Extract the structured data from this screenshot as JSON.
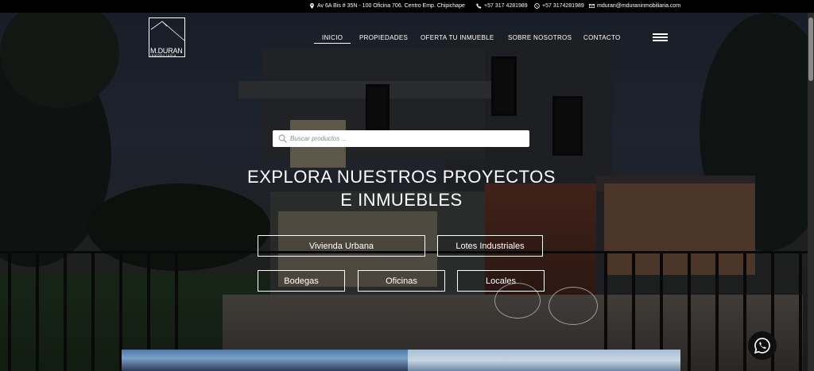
{
  "topbar": {
    "address": "Av 6A Bis # 35N - 100 Oficina 706. Centro Emp. Chipichape",
    "phone": "+57 317 4281989",
    "whatsapp": "+57 3174281989",
    "email": "mduran@mduraninmobiliaria.com"
  },
  "logo": {
    "name": "M.DURAN",
    "subtitle": "INMOBILIARIA"
  },
  "nav": {
    "items": [
      "INICIO",
      "PROPIEDADES",
      "OFERTA TU INMUEBLE",
      "SOBRE NOSOTROS",
      "CONTACTO"
    ],
    "active": "INICIO"
  },
  "search": {
    "placeholder": "Buscar productos ..."
  },
  "hero": {
    "headline_line1": "EXPLORA NUESTROS PROYECTOS",
    "headline_line2": "E INMUEBLES"
  },
  "categories": [
    "Vivienda Urbana",
    "Lotes Industriales",
    "Bodegas",
    "Oficinas",
    "Locales"
  ],
  "icons": {
    "address": "location-pin-icon",
    "phone": "phone-icon",
    "whatsapp": "whatsapp-icon",
    "email": "envelope-icon",
    "search": "search-icon",
    "menu": "hamburger-menu-icon"
  },
  "colors": {
    "topbar": "#000000",
    "text": "#ffffff",
    "whatsapp_button": "#0f0f0f"
  }
}
